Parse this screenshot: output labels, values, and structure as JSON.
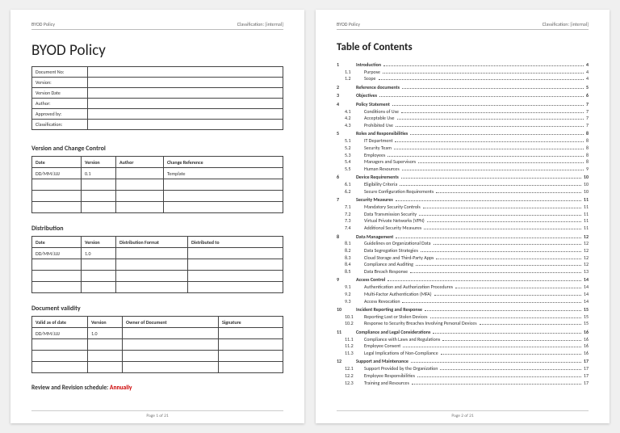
{
  "header": {
    "left": "BYOD Policy",
    "right": "Classification: [internal]"
  },
  "footer": {
    "page1": "Page 1 of 21",
    "page2": "Page 2 of 21"
  },
  "title": "BYOD Policy",
  "meta_labels": [
    "Document No:",
    "Version:",
    "Version Date",
    "Author:",
    "Approved by:",
    "Classification:"
  ],
  "sections": {
    "vcc": {
      "heading": "Version and Change Control",
      "headers": [
        "Date",
        "Version",
        "Author",
        "Change Reference"
      ],
      "rows": [
        [
          "DD/MM/JJJJ",
          "0.1",
          "",
          "Template"
        ],
        [
          "",
          "",
          "",
          ""
        ],
        [
          "",
          "",
          "",
          ""
        ],
        [
          "",
          "",
          "",
          ""
        ]
      ]
    },
    "dist": {
      "heading": "Distribution",
      "headers": [
        "Date",
        "Version",
        "Distribution Format",
        "Distributed to"
      ],
      "rows": [
        [
          "DD/MM/JJJJ",
          "1.0",
          "",
          ""
        ],
        [
          "",
          "",
          "",
          ""
        ],
        [
          "",
          "",
          "",
          ""
        ],
        [
          "",
          "",
          "",
          ""
        ]
      ]
    },
    "valid": {
      "heading": "Document validity",
      "headers": [
        "Valid as of date",
        "Version",
        "Owner of Document",
        "Signature"
      ],
      "rows": [
        [
          "DD/MM/JJJJ",
          "1.0",
          "",
          ""
        ],
        [
          "",
          "",
          "",
          ""
        ],
        [
          "",
          "",
          "",
          ""
        ],
        [
          "",
          "",
          "",
          ""
        ]
      ]
    }
  },
  "review": {
    "label": "Review and Revision schedule:",
    "value": "Annually"
  },
  "toc_title": "Table of Contents",
  "toc": [
    {
      "lvl": 1,
      "n": "1",
      "t": "Introduction",
      "p": "4"
    },
    {
      "lvl": 2,
      "n": "1.1",
      "t": "Purpose",
      "p": "4"
    },
    {
      "lvl": 2,
      "n": "1.2",
      "t": "Scope",
      "p": "4"
    },
    {
      "lvl": 1,
      "n": "2",
      "t": "Reference documents",
      "p": "5"
    },
    {
      "lvl": 1,
      "n": "3",
      "t": "Objectives",
      "p": "6"
    },
    {
      "lvl": 1,
      "n": "4",
      "t": "Policy Statement",
      "p": "7"
    },
    {
      "lvl": 2,
      "n": "4.1",
      "t": "Conditions of Use",
      "p": "7"
    },
    {
      "lvl": 2,
      "n": "4.2",
      "t": "Acceptable Use",
      "p": "7"
    },
    {
      "lvl": 2,
      "n": "4.3",
      "t": "Prohibited Use",
      "p": "7"
    },
    {
      "lvl": 1,
      "n": "5",
      "t": "Roles and Responsibilities",
      "p": "8"
    },
    {
      "lvl": 2,
      "n": "5.1",
      "t": "IT Department",
      "p": "8"
    },
    {
      "lvl": 2,
      "n": "5.2",
      "t": "Security Team",
      "p": "8"
    },
    {
      "lvl": 2,
      "n": "5.3",
      "t": "Employees",
      "p": "8"
    },
    {
      "lvl": 2,
      "n": "5.4",
      "t": "Managers and Supervisors",
      "p": "8"
    },
    {
      "lvl": 2,
      "n": "5.5",
      "t": "Human Resources",
      "p": "9"
    },
    {
      "lvl": 1,
      "n": "6",
      "t": "Device Requirements",
      "p": "10"
    },
    {
      "lvl": 2,
      "n": "6.1",
      "t": "Eligibility Criteria",
      "p": "10"
    },
    {
      "lvl": 2,
      "n": "6.2",
      "t": "Secure Configuration Requirements",
      "p": "10"
    },
    {
      "lvl": 1,
      "n": "7",
      "t": "Security Measures",
      "p": "11"
    },
    {
      "lvl": 2,
      "n": "7.1",
      "t": "Mandatory Security Controls",
      "p": "11"
    },
    {
      "lvl": 2,
      "n": "7.2",
      "t": "Data Transmission Security",
      "p": "11"
    },
    {
      "lvl": 2,
      "n": "7.3",
      "t": "Virtual Private Networks (VPN)",
      "p": "11"
    },
    {
      "lvl": 2,
      "n": "7.4",
      "t": "Additional Security Measures",
      "p": "11"
    },
    {
      "lvl": 1,
      "n": "8",
      "t": "Data Management",
      "p": "12"
    },
    {
      "lvl": 2,
      "n": "8.1",
      "t": "Guidelines on Organizational Data",
      "p": "12"
    },
    {
      "lvl": 2,
      "n": "8.2",
      "t": "Data Segregation Strategies",
      "p": "12"
    },
    {
      "lvl": 2,
      "n": "8.3",
      "t": "Cloud Storage and Third-Party Apps",
      "p": "12"
    },
    {
      "lvl": 2,
      "n": "8.4",
      "t": "Compliance and Auditing",
      "p": "12"
    },
    {
      "lvl": 2,
      "n": "8.5",
      "t": "Data Breach Response",
      "p": "13"
    },
    {
      "lvl": 1,
      "n": "9",
      "t": "Access Control",
      "p": "14"
    },
    {
      "lvl": 2,
      "n": "9.1",
      "t": "Authentication and Authorization Procedures",
      "p": "14"
    },
    {
      "lvl": 2,
      "n": "9.2",
      "t": "Multi-Factor Authentication (MFA)",
      "p": "14"
    },
    {
      "lvl": 2,
      "n": "9.3",
      "t": "Access Revocation",
      "p": "14"
    },
    {
      "lvl": 1,
      "n": "10",
      "t": "Incident Reporting and Response",
      "p": "15"
    },
    {
      "lvl": 2,
      "n": "10.1",
      "t": "Reporting Lost or Stolen Devices",
      "p": "15"
    },
    {
      "lvl": 2,
      "n": "10.2",
      "t": "Response to Security Breaches Involving Personal Devices",
      "p": "15"
    },
    {
      "lvl": 1,
      "n": "11",
      "t": "Compliance and Legal Considerations",
      "p": "16"
    },
    {
      "lvl": 2,
      "n": "11.1",
      "t": "Compliance with Laws and Regulations",
      "p": "16"
    },
    {
      "lvl": 2,
      "n": "11.2",
      "t": "Employee Consent",
      "p": "16"
    },
    {
      "lvl": 2,
      "n": "11.3",
      "t": "Legal Implications of Non-Compliance",
      "p": "16"
    },
    {
      "lvl": 1,
      "n": "12",
      "t": "Support and Maintenance",
      "p": "17"
    },
    {
      "lvl": 2,
      "n": "12.1",
      "t": "Support Provided by the Organization",
      "p": "17"
    },
    {
      "lvl": 2,
      "n": "12.2",
      "t": "Employee Responsibilities",
      "p": "17"
    },
    {
      "lvl": 2,
      "n": "12.3",
      "t": "Training and Resources",
      "p": "17"
    }
  ]
}
